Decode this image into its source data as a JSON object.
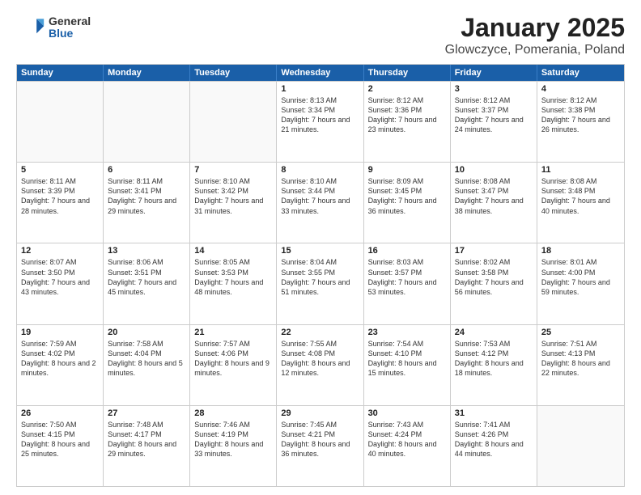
{
  "header": {
    "logo": {
      "general": "General",
      "blue": "Blue"
    },
    "title": "January 2025",
    "location": "Glowczyce, Pomerania, Poland"
  },
  "weekdays": [
    "Sunday",
    "Monday",
    "Tuesday",
    "Wednesday",
    "Thursday",
    "Friday",
    "Saturday"
  ],
  "rows": [
    [
      {
        "day": "",
        "empty": true
      },
      {
        "day": "",
        "empty": true
      },
      {
        "day": "",
        "empty": true
      },
      {
        "day": "1",
        "sunrise": "8:13 AM",
        "sunset": "3:34 PM",
        "daylight": "7 hours and 21 minutes."
      },
      {
        "day": "2",
        "sunrise": "8:12 AM",
        "sunset": "3:36 PM",
        "daylight": "7 hours and 23 minutes."
      },
      {
        "day": "3",
        "sunrise": "8:12 AM",
        "sunset": "3:37 PM",
        "daylight": "7 hours and 24 minutes."
      },
      {
        "day": "4",
        "sunrise": "8:12 AM",
        "sunset": "3:38 PM",
        "daylight": "7 hours and 26 minutes."
      }
    ],
    [
      {
        "day": "5",
        "sunrise": "8:11 AM",
        "sunset": "3:39 PM",
        "daylight": "7 hours and 28 minutes."
      },
      {
        "day": "6",
        "sunrise": "8:11 AM",
        "sunset": "3:41 PM",
        "daylight": "7 hours and 29 minutes."
      },
      {
        "day": "7",
        "sunrise": "8:10 AM",
        "sunset": "3:42 PM",
        "daylight": "7 hours and 31 minutes."
      },
      {
        "day": "8",
        "sunrise": "8:10 AM",
        "sunset": "3:44 PM",
        "daylight": "7 hours and 33 minutes."
      },
      {
        "day": "9",
        "sunrise": "8:09 AM",
        "sunset": "3:45 PM",
        "daylight": "7 hours and 36 minutes."
      },
      {
        "day": "10",
        "sunrise": "8:08 AM",
        "sunset": "3:47 PM",
        "daylight": "7 hours and 38 minutes."
      },
      {
        "day": "11",
        "sunrise": "8:08 AM",
        "sunset": "3:48 PM",
        "daylight": "7 hours and 40 minutes."
      }
    ],
    [
      {
        "day": "12",
        "sunrise": "8:07 AM",
        "sunset": "3:50 PM",
        "daylight": "7 hours and 43 minutes."
      },
      {
        "day": "13",
        "sunrise": "8:06 AM",
        "sunset": "3:51 PM",
        "daylight": "7 hours and 45 minutes."
      },
      {
        "day": "14",
        "sunrise": "8:05 AM",
        "sunset": "3:53 PM",
        "daylight": "7 hours and 48 minutes."
      },
      {
        "day": "15",
        "sunrise": "8:04 AM",
        "sunset": "3:55 PM",
        "daylight": "7 hours and 51 minutes."
      },
      {
        "day": "16",
        "sunrise": "8:03 AM",
        "sunset": "3:57 PM",
        "daylight": "7 hours and 53 minutes."
      },
      {
        "day": "17",
        "sunrise": "8:02 AM",
        "sunset": "3:58 PM",
        "daylight": "7 hours and 56 minutes."
      },
      {
        "day": "18",
        "sunrise": "8:01 AM",
        "sunset": "4:00 PM",
        "daylight": "7 hours and 59 minutes."
      }
    ],
    [
      {
        "day": "19",
        "sunrise": "7:59 AM",
        "sunset": "4:02 PM",
        "daylight": "8 hours and 2 minutes."
      },
      {
        "day": "20",
        "sunrise": "7:58 AM",
        "sunset": "4:04 PM",
        "daylight": "8 hours and 5 minutes."
      },
      {
        "day": "21",
        "sunrise": "7:57 AM",
        "sunset": "4:06 PM",
        "daylight": "8 hours and 9 minutes."
      },
      {
        "day": "22",
        "sunrise": "7:55 AM",
        "sunset": "4:08 PM",
        "daylight": "8 hours and 12 minutes."
      },
      {
        "day": "23",
        "sunrise": "7:54 AM",
        "sunset": "4:10 PM",
        "daylight": "8 hours and 15 minutes."
      },
      {
        "day": "24",
        "sunrise": "7:53 AM",
        "sunset": "4:12 PM",
        "daylight": "8 hours and 18 minutes."
      },
      {
        "day": "25",
        "sunrise": "7:51 AM",
        "sunset": "4:13 PM",
        "daylight": "8 hours and 22 minutes."
      }
    ],
    [
      {
        "day": "26",
        "sunrise": "7:50 AM",
        "sunset": "4:15 PM",
        "daylight": "8 hours and 25 minutes."
      },
      {
        "day": "27",
        "sunrise": "7:48 AM",
        "sunset": "4:17 PM",
        "daylight": "8 hours and 29 minutes."
      },
      {
        "day": "28",
        "sunrise": "7:46 AM",
        "sunset": "4:19 PM",
        "daylight": "8 hours and 33 minutes."
      },
      {
        "day": "29",
        "sunrise": "7:45 AM",
        "sunset": "4:21 PM",
        "daylight": "8 hours and 36 minutes."
      },
      {
        "day": "30",
        "sunrise": "7:43 AM",
        "sunset": "4:24 PM",
        "daylight": "8 hours and 40 minutes."
      },
      {
        "day": "31",
        "sunrise": "7:41 AM",
        "sunset": "4:26 PM",
        "daylight": "8 hours and 44 minutes."
      },
      {
        "day": "",
        "empty": true
      }
    ]
  ]
}
